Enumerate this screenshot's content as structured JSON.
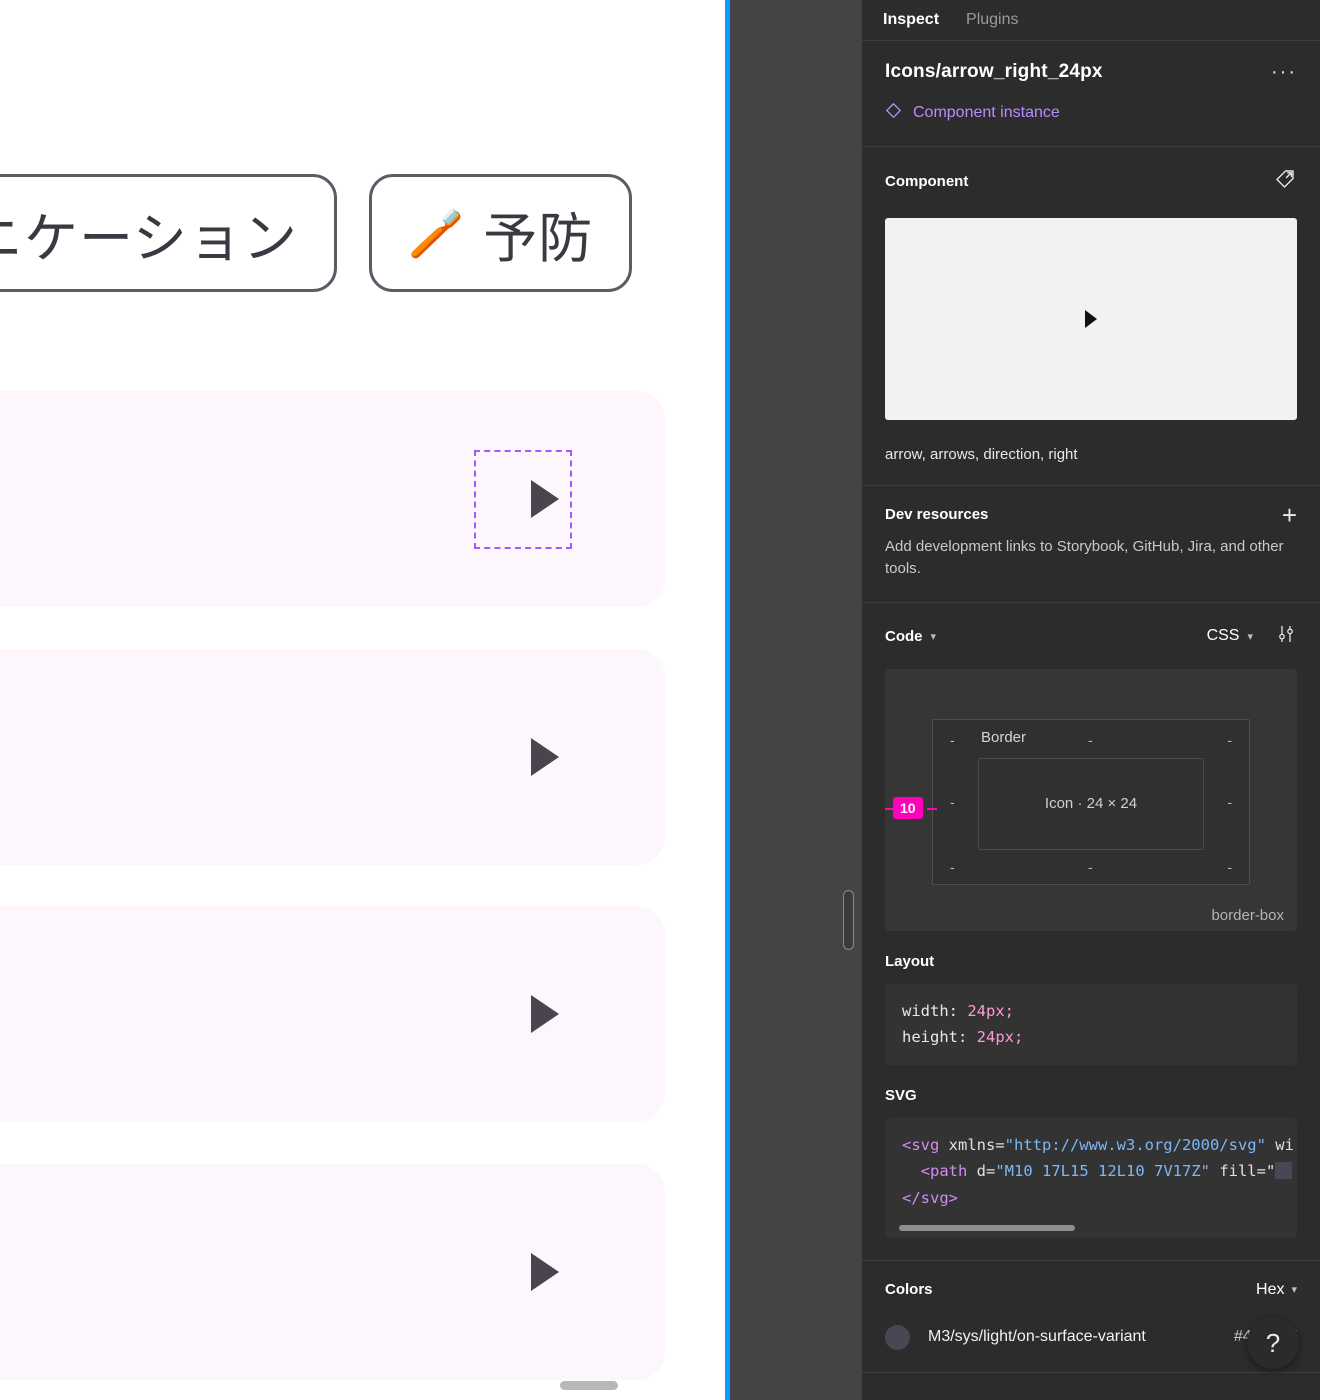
{
  "canvas": {
    "chips": [
      {
        "label": "ニケーション",
        "emoji": ""
      },
      {
        "label": "予防",
        "emoji": "🪥"
      }
    ],
    "rows": [
      {
        "arrow_icon": "arrow-right-icon",
        "selected": true
      },
      {
        "arrow_icon": "arrow-right-icon",
        "selected": false
      },
      {
        "arrow_icon": "arrow-right-icon",
        "selected": false
      },
      {
        "arrow_icon": "arrow-right-icon",
        "selected": false
      }
    ]
  },
  "panel": {
    "tabs": [
      {
        "label": "Inspect",
        "active": true
      },
      {
        "label": "Plugins",
        "active": false
      }
    ],
    "node": {
      "title": "Icons/arrow_right_24px",
      "more_label": "···",
      "instance_label": "Component instance",
      "instance_icon": "diamond-icon"
    },
    "component": {
      "heading": "Component",
      "goto_icon": "go-to-component-icon",
      "preview_icon": "arrow-right-icon",
      "keywords": "arrow, arrows, direction, right"
    },
    "dev_resources": {
      "heading": "Dev resources",
      "add_icon": "plus-icon",
      "description": "Add development links to Storybook, GitHub, Jira, and other tools."
    },
    "code": {
      "heading": "Code",
      "heading_chevron": "chevron-down-icon",
      "language": "CSS",
      "language_chevron": "chevron-down-icon",
      "settings_icon": "sliders-icon",
      "boxmodel": {
        "border_label": "Border",
        "inner_label": "Icon · 24 × 24",
        "dash": "-",
        "measure_value": "10",
        "sizing": "border-box"
      },
      "layout": {
        "heading": "Layout",
        "lines": [
          {
            "prop": "width:",
            "value": "24px;"
          },
          {
            "prop": "height:",
            "value": "24px;"
          }
        ]
      },
      "svg": {
        "heading": "SVG",
        "line1_tag_open": "<svg",
        "line1_attr": " xmlns=",
        "line1_str": "\"http://www.w3.org/2000/svg\"",
        "line1_tail": " wi",
        "line2_tag_open": "<path",
        "line2_attr": " d=",
        "line2_str": "\"M10 17L15 12L10 7V17Z\"",
        "line2_tail": " fill=\"",
        "line3": "</svg>"
      }
    },
    "colors": {
      "heading": "Colors",
      "format": "Hex",
      "format_chevron": "chevron-down-icon",
      "items": [
        {
          "name": "M3/sys/light/on-surface-variant",
          "hex": "#49454F",
          "swatch": "#4A4754"
        }
      ]
    },
    "help_label": "?"
  }
}
